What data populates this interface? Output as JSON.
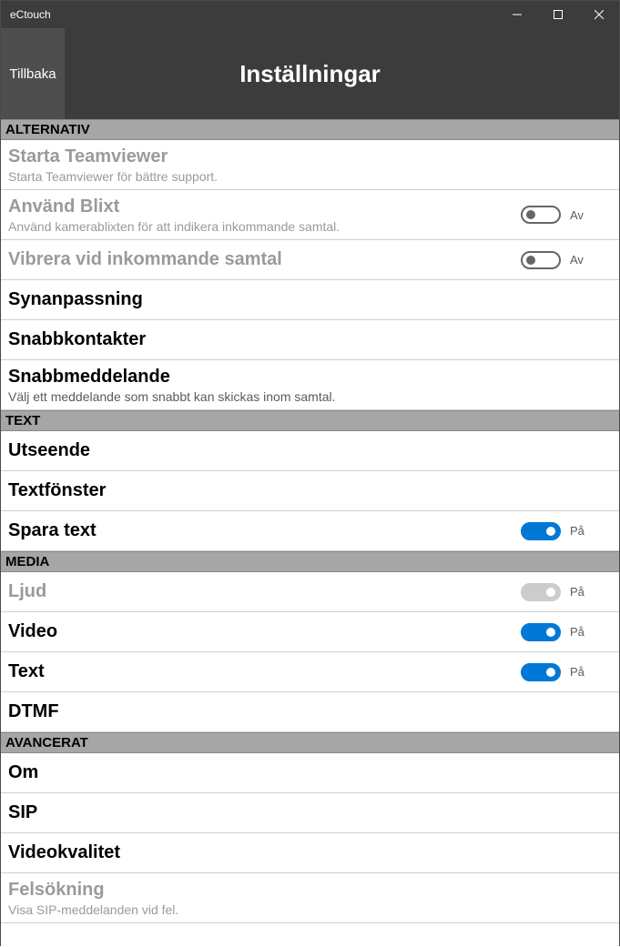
{
  "window": {
    "title": "eCtouch"
  },
  "header": {
    "back": "Tillbaka",
    "title": "Inställningar"
  },
  "labels": {
    "on": "På",
    "off": "Av"
  },
  "sections": {
    "alternativ": {
      "header": "ALTERNATIV",
      "teamviewer": {
        "title": "Starta Teamviewer",
        "sub": "Starta Teamviewer för bättre support."
      },
      "blixt": {
        "title": "Använd Blixt",
        "sub": "Använd kamerablixten för att indikera inkommande samtal.",
        "state": "off"
      },
      "vibrera": {
        "title": "Vibrera vid inkommande samtal",
        "state": "off"
      },
      "synanpassning": {
        "title": "Synanpassning"
      },
      "snabbkontakter": {
        "title": "Snabbkontakter"
      },
      "snabbmeddelande": {
        "title": "Snabbmeddelande",
        "sub": "Välj ett meddelande som snabbt kan skickas inom samtal."
      }
    },
    "text": {
      "header": "TEXT",
      "utseende": {
        "title": "Utseende"
      },
      "textfonster": {
        "title": "Textfönster"
      },
      "spara": {
        "title": "Spara text",
        "state": "on"
      }
    },
    "media": {
      "header": "MEDIA",
      "ljud": {
        "title": "Ljud",
        "state": "on_disabled"
      },
      "video": {
        "title": "Video",
        "state": "on"
      },
      "text": {
        "title": "Text",
        "state": "on"
      },
      "dtmf": {
        "title": "DTMF"
      }
    },
    "avancerat": {
      "header": "AVANCERAT",
      "om": {
        "title": "Om"
      },
      "sip": {
        "title": "SIP"
      },
      "videokvalitet": {
        "title": "Videokvalitet"
      },
      "felsokning": {
        "title": "Felsökning",
        "sub": "Visa SIP-meddelanden vid fel."
      }
    }
  }
}
